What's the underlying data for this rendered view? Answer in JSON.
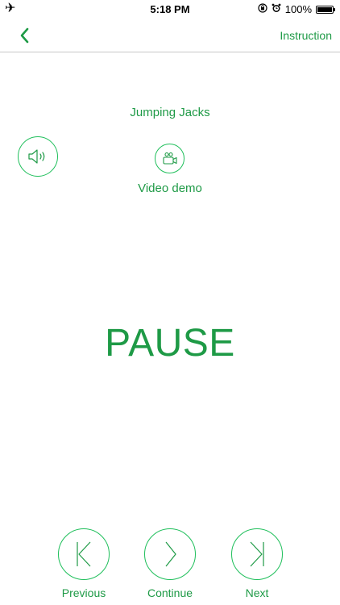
{
  "status_bar": {
    "airplane_icon": "airplane-icon",
    "time": "5:18 PM",
    "battery_percent": "100%"
  },
  "nav": {
    "back_icon": "chevron-left-icon",
    "instruction_label": "Instruction"
  },
  "exercise": {
    "title": "Jumping Jacks"
  },
  "media": {
    "sound_icon": "speaker-icon",
    "video_icon": "video-camera-icon",
    "video_label": "Video demo"
  },
  "state": {
    "label": "PAUSE"
  },
  "controls": {
    "previous_label": "Previous",
    "continue_label": "Continue",
    "next_label": "Next"
  },
  "colors": {
    "accent": "#1e9a46",
    "circle_stroke": "#1fbf5b"
  }
}
